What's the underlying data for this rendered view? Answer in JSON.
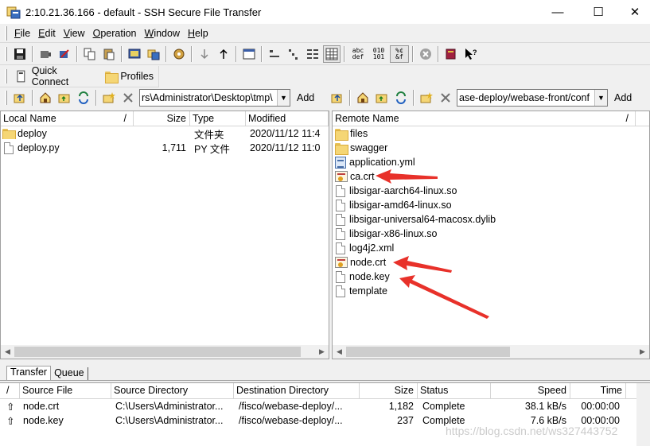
{
  "window": {
    "title": "2:10.21.36.166 - default - SSH Secure File Transfer",
    "minimize": "—",
    "maximize": "☐",
    "close": "✕"
  },
  "menu": {
    "items": [
      {
        "key": "F",
        "rest": "ile"
      },
      {
        "key": "E",
        "rest": "dit"
      },
      {
        "key": "V",
        "rest": "iew"
      },
      {
        "key": "O",
        "rest": "peration"
      },
      {
        "key": "W",
        "rest": "indow"
      },
      {
        "key": "H",
        "rest": "elp"
      }
    ]
  },
  "toolbar": {
    "abc_label_top": "abc",
    "abc_label_bottom": "def",
    "bin_label_top": "010",
    "bin_label_bottom": "101",
    "pct_label_top": "%¢",
    "pct_label_bottom": "&f"
  },
  "quickbar": {
    "quick_connect": "Quick Connect",
    "profiles": "Profiles"
  },
  "local": {
    "path": "rs\\Administrator\\Desktop\\tmp\\",
    "add": "Add",
    "headers": {
      "name": "Local Name",
      "sort": "/",
      "size": "Size",
      "type": "Type",
      "modified": "Modified"
    },
    "files": [
      {
        "name": "deploy",
        "size": "",
        "type": "文件夹",
        "modified": "2020/11/12 11:4",
        "kind": "folder"
      },
      {
        "name": "deploy.py",
        "size": "1,711",
        "type": "PY 文件",
        "modified": "2020/11/12 11:0",
        "kind": "file"
      }
    ]
  },
  "remote": {
    "path": "ase-deploy/webase-front/conf",
    "add": "Add",
    "headers": {
      "name": "Remote Name",
      "sort": "/"
    },
    "files": [
      {
        "name": "files",
        "kind": "folder"
      },
      {
        "name": "swagger",
        "kind": "folder"
      },
      {
        "name": "application.yml",
        "kind": "yml"
      },
      {
        "name": "ca.crt",
        "kind": "cert"
      },
      {
        "name": "libsigar-aarch64-linux.so",
        "kind": "file"
      },
      {
        "name": "libsigar-amd64-linux.so",
        "kind": "file"
      },
      {
        "name": "libsigar-universal64-macosx.dylib",
        "kind": "file"
      },
      {
        "name": "libsigar-x86-linux.so",
        "kind": "file"
      },
      {
        "name": "log4j2.xml",
        "kind": "file"
      },
      {
        "name": "node.crt",
        "kind": "cert"
      },
      {
        "name": "node.key",
        "kind": "file"
      },
      {
        "name": "template",
        "kind": "file"
      }
    ]
  },
  "transfer": {
    "tabs": [
      "Transfer",
      "Queue"
    ],
    "headers": {
      "sort": "/",
      "source_file": "Source File",
      "source_dir": "Source Directory",
      "dest_dir": "Destination Directory",
      "size": "Size",
      "status": "Status",
      "speed": "Speed",
      "time": "Time"
    },
    "rows": [
      {
        "file": "node.crt",
        "src": "C:\\Users\\Administrator...",
        "dst": "/fisco/webase-deploy/...",
        "size": "1,182",
        "status": "Complete",
        "speed": "38.1 kB/s",
        "time": "00:00:00"
      },
      {
        "file": "node.key",
        "src": "C:\\Users\\Administrator...",
        "dst": "/fisco/webase-deploy/...",
        "size": "237",
        "status": "Complete",
        "speed": "7.6 kB/s",
        "time": "00:00:00"
      }
    ]
  },
  "watermark": "https://blog.csdn.net/ws327443752",
  "colors": {
    "arrow": "#e8312a",
    "folder": "#f5d675"
  }
}
